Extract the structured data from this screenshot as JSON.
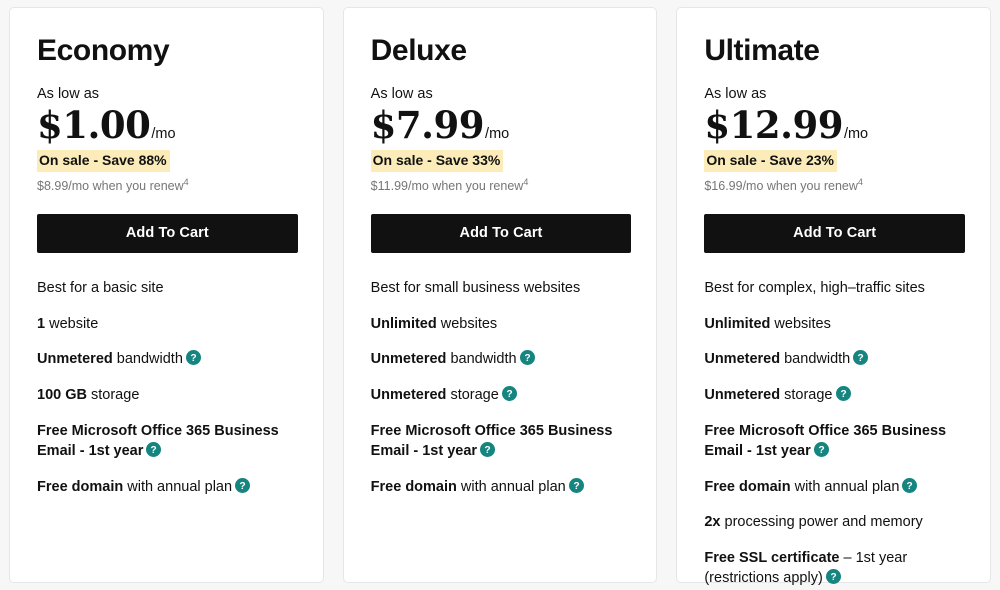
{
  "theme": {
    "page_background": "#f7f7f7",
    "card_background": "#ffffff",
    "card_border": "#e6e6e6",
    "text_primary": "#111111",
    "text_muted": "#767676",
    "sale_highlight": "#fbecb9",
    "button_background": "#111111",
    "button_text": "#ffffff",
    "help_icon_color": "#16857f"
  },
  "icons": {
    "help": "help-question-icon"
  },
  "plans": [
    {
      "name": "Economy",
      "as_low_as_label": "As low as",
      "price": "$1.00",
      "price_period": "/mo",
      "sale_badge": "On sale - Save 88%",
      "renew_note": "$8.99/mo when you renew",
      "renew_footnote": "4",
      "cta_label": "Add To Cart",
      "features": [
        {
          "strong": "",
          "rest": "Best for a basic site",
          "help": false
        },
        {
          "strong": "1",
          "rest": " website",
          "help": false
        },
        {
          "strong": "Unmetered",
          "rest": " bandwidth",
          "help": true
        },
        {
          "strong": "100 GB",
          "rest": " storage",
          "help": false
        },
        {
          "strong": "Free Microsoft Office 365 Business Email - 1st year",
          "rest": "",
          "help": true
        },
        {
          "strong": "Free domain",
          "rest": " with annual plan",
          "help": true
        }
      ]
    },
    {
      "name": "Deluxe",
      "as_low_as_label": "As low as",
      "price": "$7.99",
      "price_period": "/mo",
      "sale_badge": "On sale - Save 33%",
      "renew_note": "$11.99/mo when you renew",
      "renew_footnote": "4",
      "cta_label": "Add To Cart",
      "features": [
        {
          "strong": "",
          "rest": "Best for small business websites",
          "help": false
        },
        {
          "strong": "Unlimited",
          "rest": " websites",
          "help": false
        },
        {
          "strong": "Unmetered",
          "rest": " bandwidth",
          "help": true
        },
        {
          "strong": "Unmetered",
          "rest": " storage",
          "help": true
        },
        {
          "strong": "Free Microsoft Office 365 Business Email - 1st year",
          "rest": "",
          "help": true
        },
        {
          "strong": "Free domain",
          "rest": " with annual plan",
          "help": true
        }
      ]
    },
    {
      "name": "Ultimate",
      "as_low_as_label": "As low as",
      "price": "$12.99",
      "price_period": "/mo",
      "sale_badge": "On sale - Save 23%",
      "renew_note": "$16.99/mo when you renew",
      "renew_footnote": "4",
      "cta_label": "Add To Cart",
      "features": [
        {
          "strong": "",
          "rest": "Best for complex, high–traffic sites",
          "help": false
        },
        {
          "strong": "Unlimited",
          "rest": " websites",
          "help": false
        },
        {
          "strong": "Unmetered",
          "rest": " bandwidth",
          "help": true
        },
        {
          "strong": "Unmetered",
          "rest": " storage",
          "help": true
        },
        {
          "strong": "Free Microsoft Office 365 Business Email - 1st year",
          "rest": "",
          "help": true
        },
        {
          "strong": "Free domain",
          "rest": " with annual plan",
          "help": true
        },
        {
          "strong": "2x",
          "rest": " processing power and memory",
          "help": false
        },
        {
          "strong": "Free SSL certificate",
          "rest": " – 1st year (restrictions apply)",
          "help": true
        }
      ]
    }
  ]
}
